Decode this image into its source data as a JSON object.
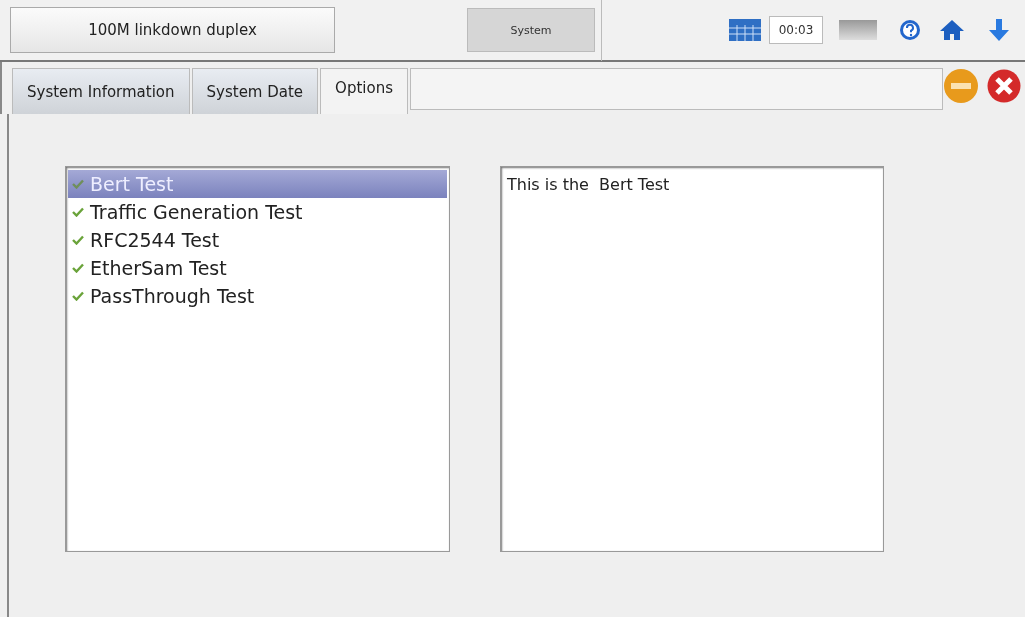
{
  "status": {
    "label": "100M linkdown duplex"
  },
  "module_button": {
    "label": "System"
  },
  "timer": {
    "value": "00:03"
  },
  "tabs": [
    {
      "label": "System Information",
      "selected": false
    },
    {
      "label": "System Date",
      "selected": false
    },
    {
      "label": "Options",
      "selected": true
    }
  ],
  "tests": [
    {
      "label": "Bert Test",
      "checked": true,
      "selected": true
    },
    {
      "label": "Traffic Generation Test",
      "checked": true,
      "selected": false
    },
    {
      "label": "RFC2544 Test",
      "checked": true,
      "selected": false
    },
    {
      "label": "EtherSam Test",
      "checked": true,
      "selected": false
    },
    {
      "label": "PassThrough Test",
      "checked": true,
      "selected": false
    }
  ],
  "description": "This is the  Bert Test"
}
